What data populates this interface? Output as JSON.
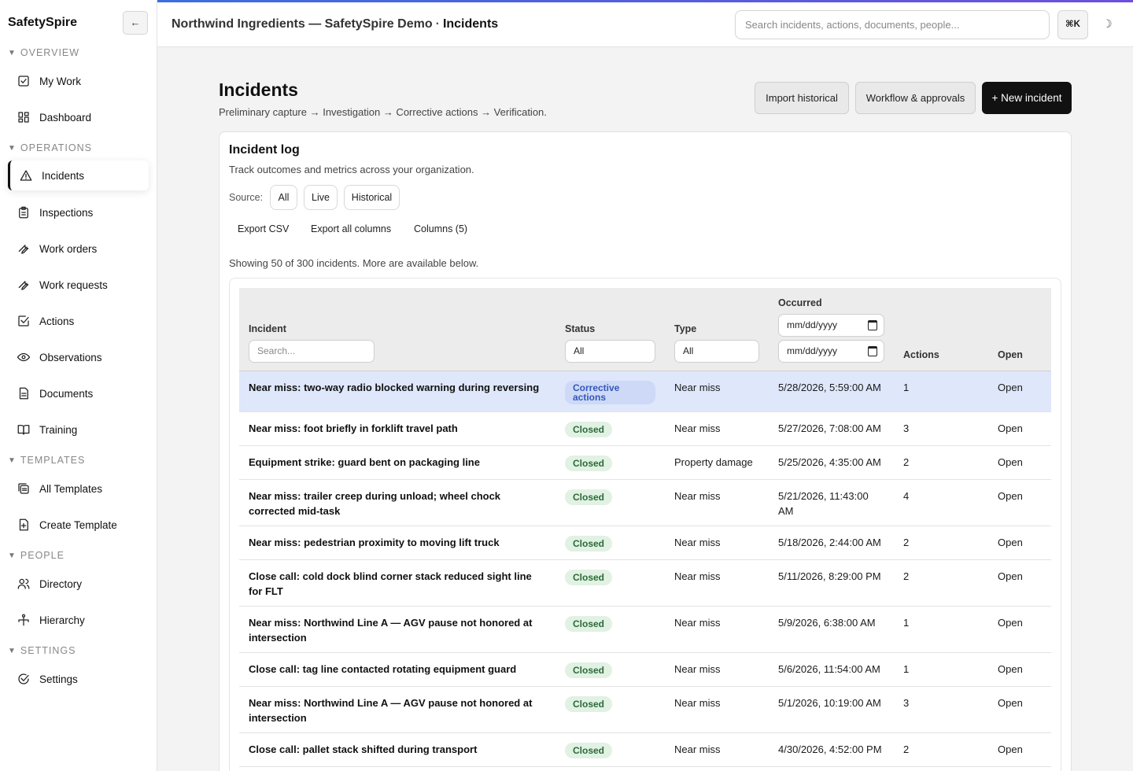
{
  "sidebar": {
    "brand": "SafetySpire",
    "collapse_glyph": "←",
    "sections": [
      {
        "label": "OVERVIEW",
        "items": [
          {
            "label": "My Work",
            "icon": "check-square-icon"
          },
          {
            "label": "Dashboard",
            "icon": "grid-icon"
          }
        ]
      },
      {
        "label": "OPERATIONS",
        "items": [
          {
            "label": "Incidents",
            "icon": "warning-triangle-icon",
            "active": true
          },
          {
            "label": "Inspections",
            "icon": "clipboard-icon"
          },
          {
            "label": "Work orders",
            "icon": "wrench-icon"
          },
          {
            "label": "Work requests",
            "icon": "wrench-icon"
          },
          {
            "label": "Actions",
            "icon": "checkbox-icon"
          },
          {
            "label": "Observations",
            "icon": "eye-icon"
          },
          {
            "label": "Documents",
            "icon": "document-icon"
          },
          {
            "label": "Training",
            "icon": "book-icon"
          }
        ]
      },
      {
        "label": "TEMPLATES",
        "items": [
          {
            "label": "All Templates",
            "icon": "layers-icon"
          },
          {
            "label": "Create Template",
            "icon": "file-plus-icon"
          }
        ]
      },
      {
        "label": "PEOPLE",
        "items": [
          {
            "label": "Directory",
            "icon": "users-icon"
          },
          {
            "label": "Hierarchy",
            "icon": "hierarchy-icon"
          }
        ]
      },
      {
        "label": "SETTINGS",
        "items": [
          {
            "label": "Settings",
            "icon": "check-circle-icon"
          }
        ]
      }
    ]
  },
  "topbar": {
    "org": "Northwind Ingredients — SafetySpire Demo",
    "separator": "·",
    "current": "Incidents",
    "search_placeholder": "Search incidents, actions, documents, people...",
    "shortcut": "⌘K",
    "theme_glyph": "☽",
    "accent_gradient": [
      "#3b6ee0",
      "#6d4fe0"
    ]
  },
  "page": {
    "title": "Incidents",
    "subtitle": "Preliminary capture → Investigation → Corrective actions → Verification.",
    "buttons": {
      "import": "Import historical",
      "workflow": "Workflow & approvals",
      "new": "+ New incident"
    }
  },
  "card": {
    "title": "Incident log",
    "subtitle": "Track outcomes and metrics across your organization.",
    "source_label": "Source:",
    "source_options": [
      "All",
      "Live",
      "Historical"
    ],
    "tools": [
      "Export CSV",
      "Export all columns",
      "Columns (5)"
    ],
    "showing": "Showing 50 of 300 incidents. More are available below."
  },
  "table": {
    "headers": {
      "incident": "Incident",
      "status": "Status",
      "type": "Type",
      "occurred": "Occurred",
      "actions": "Actions",
      "open": "Open"
    },
    "filters": {
      "search_placeholder": "Search...",
      "status": "All",
      "type": "All",
      "date_from": "mm/dd/yyyy",
      "date_to": "mm/dd/yyyy"
    },
    "rows": [
      {
        "incident": "Near miss: two-way radio blocked warning during reversing",
        "status": "Corrective actions",
        "type": "Near miss",
        "occurred": "5/28/2026, 5:59:00 AM",
        "actions": "1",
        "open": "Open",
        "selected": true
      },
      {
        "incident": "Near miss: foot briefly in forklift travel path",
        "status": "Closed",
        "type": "Near miss",
        "occurred": "5/27/2026, 7:08:00 AM",
        "actions": "3",
        "open": "Open"
      },
      {
        "incident": "Equipment strike: guard bent on packaging line",
        "status": "Closed",
        "type": "Property damage",
        "occurred": "5/25/2026, 4:35:00 AM",
        "actions": "2",
        "open": "Open"
      },
      {
        "incident": "Near miss: trailer creep during unload; wheel chock corrected mid-task",
        "status": "Closed",
        "type": "Near miss",
        "occurred": "5/21/2026, 11:43:00 AM",
        "actions": "4",
        "open": "Open"
      },
      {
        "incident": "Near miss: pedestrian proximity to moving lift truck",
        "status": "Closed",
        "type": "Near miss",
        "occurred": "5/18/2026, 2:44:00 AM",
        "actions": "2",
        "open": "Open"
      },
      {
        "incident": "Close call: cold dock blind corner stack reduced sight line for FLT",
        "status": "Closed",
        "type": "Near miss",
        "occurred": "5/11/2026, 8:29:00 PM",
        "actions": "2",
        "open": "Open"
      },
      {
        "incident": "Near miss: Northwind Line A — AGV pause not honored at intersection",
        "status": "Closed",
        "type": "Near miss",
        "occurred": "5/9/2026, 6:38:00 AM",
        "actions": "1",
        "open": "Open"
      },
      {
        "incident": "Close call: tag line contacted rotating equipment guard",
        "status": "Closed",
        "type": "Near miss",
        "occurred": "5/6/2026, 11:54:00 AM",
        "actions": "1",
        "open": "Open"
      },
      {
        "incident": "Near miss: Northwind Line A — AGV pause not honored at intersection",
        "status": "Closed",
        "type": "Near miss",
        "occurred": "5/1/2026, 10:19:00 AM",
        "actions": "3",
        "open": "Open"
      },
      {
        "incident": "Close call: pallet stack shifted during transport",
        "status": "Closed",
        "type": "Near miss",
        "occurred": "4/30/2026, 4:52:00 PM",
        "actions": "2",
        "open": "Open"
      }
    ]
  },
  "colors": {
    "selected_row": "#dfe7fb",
    "closed_badge_bg": "#e1f1e3",
    "closed_badge_text": "#2b6b37",
    "ca_badge_bg": "#cdd9f6",
    "ca_badge_text": "#3458b8",
    "primary_button": "#111111"
  }
}
